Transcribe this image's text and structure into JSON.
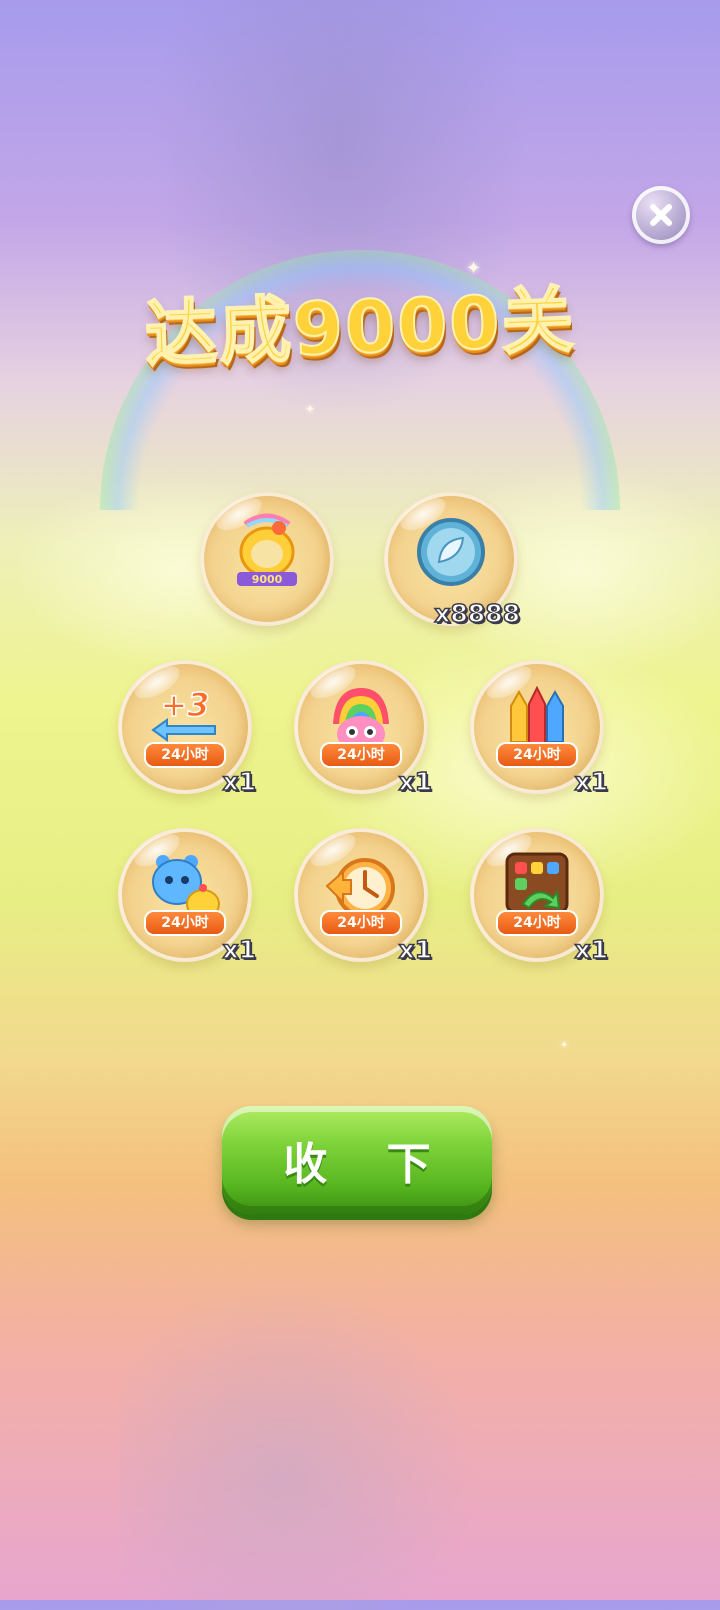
{
  "dialog": {
    "title": "达成9000关",
    "close_icon": "close-icon",
    "collect_label": "收 下"
  },
  "rewards": [
    {
      "id": "avatar-frame",
      "icon": "chicken-avatar-frame-icon",
      "badge": "9000",
      "timer": "",
      "quantity": ""
    },
    {
      "id": "coins",
      "icon": "leaf-coin-icon",
      "timer": "",
      "quantity": "x8888"
    },
    {
      "id": "extra-moves",
      "icon": "plus-three-moves-icon",
      "badge": "+3",
      "timer": "24小时",
      "quantity": "x1"
    },
    {
      "id": "rainbow-bird",
      "icon": "rainbow-bird-icon",
      "timer": "24小时",
      "quantity": "x1"
    },
    {
      "id": "rockets",
      "icon": "rockets-icon",
      "timer": "24小时",
      "quantity": "x1"
    },
    {
      "id": "animal-pair",
      "icon": "animal-pair-icon",
      "timer": "24小时",
      "quantity": "x1"
    },
    {
      "id": "time-back",
      "icon": "clock-rewind-icon",
      "timer": "24小时",
      "quantity": "x1"
    },
    {
      "id": "shuffle",
      "icon": "shuffle-board-icon",
      "timer": "24小时",
      "quantity": "x1"
    }
  ],
  "colors": {
    "title_gold": "#ffd23a",
    "button_green": "#7fd33a",
    "timer_orange": "#f07024"
  }
}
